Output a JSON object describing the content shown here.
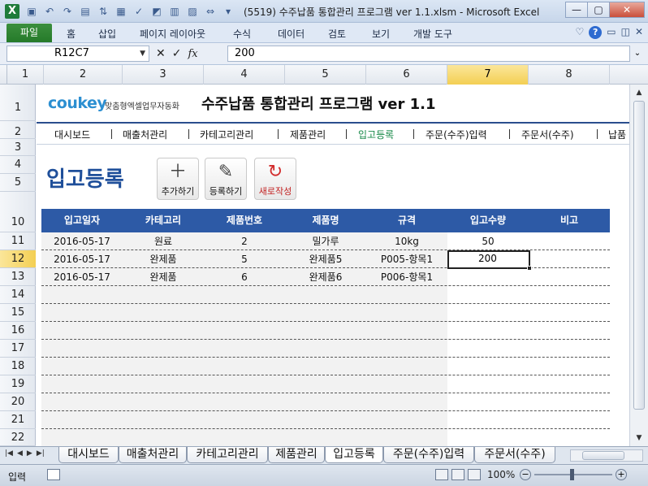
{
  "window": {
    "title": "(5519) 수주납품 통합관리 프로그램 ver 1.1.xlsm  -  Microsoft Excel",
    "minimize": "—",
    "restore": "▢",
    "close": "✕"
  },
  "ribbon": {
    "file_tab": "파일",
    "tabs": [
      "홈",
      "삽입",
      "페이지 레이아웃",
      "수식",
      "데이터",
      "검토",
      "보기",
      "개발 도구"
    ]
  },
  "formula_bar": {
    "name_box": "R12C7",
    "formula": "200"
  },
  "columns": [
    "1",
    "2",
    "3",
    "4",
    "5",
    "6",
    "7",
    "8"
  ],
  "selected_column": "7",
  "rows": [
    "1",
    "2",
    "3",
    "4",
    "5",
    "10",
    "11",
    "12",
    "13",
    "14",
    "15",
    "16",
    "17",
    "18",
    "19",
    "20",
    "21",
    "22"
  ],
  "selected_row": "12",
  "sheet": {
    "brand": "coukey",
    "brand_tagline": "맞춤형엑셀업무자동화",
    "title": "수주납품 통합관리 프로그램 ver 1.1",
    "menu": [
      "대시보드",
      "매출처관리",
      "카테고리관리",
      "제품관리",
      "입고등록",
      "주문(수주)입력",
      "주문서(수주)",
      "납품"
    ],
    "active_menu": "입고등록",
    "page_heading": "입고등록",
    "buttons": {
      "add": "추가하기",
      "register": "등록하기",
      "new": "새로작성"
    },
    "table": {
      "headers": [
        "입고일자",
        "카테고리",
        "제품번호",
        "제품명",
        "규격",
        "입고수량",
        "비고"
      ],
      "rows": [
        [
          "2016-05-17",
          "원료",
          "2",
          "밀가루",
          "10kg",
          "50",
          ""
        ],
        [
          "2016-05-17",
          "완제품",
          "5",
          "완제품5",
          "P005-항목1",
          "200",
          ""
        ],
        [
          "2016-05-17",
          "완제품",
          "6",
          "완제품6",
          "P006-항목1",
          "",
          ""
        ]
      ]
    }
  },
  "sheet_tabs": [
    "대시보드",
    "매출처관리",
    "카테고리관리",
    "제품관리",
    "입고등록",
    "주문(수주)입력",
    "주문서(수주)"
  ],
  "active_sheet_tab": "입고등록",
  "status": {
    "mode": "입력",
    "zoom": "100%"
  }
}
